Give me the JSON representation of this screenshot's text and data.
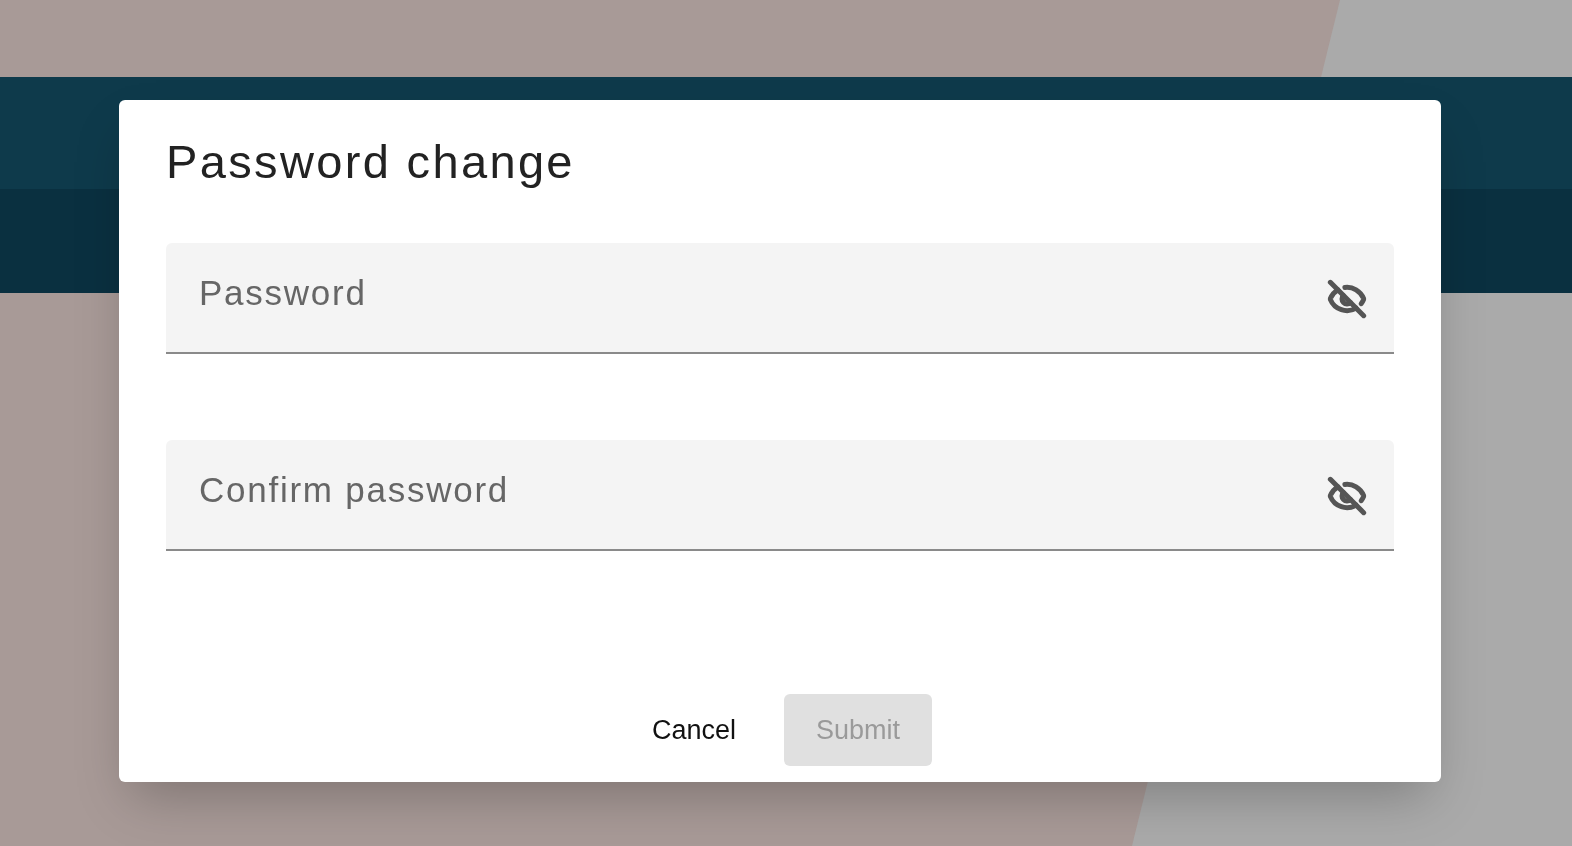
{
  "dialog": {
    "title": "Password change",
    "fields": [
      {
        "placeholder": "Password"
      },
      {
        "placeholder": "Confirm password"
      }
    ],
    "buttons": [
      {
        "label": "Cancel",
        "disabled": false
      },
      {
        "label": "Submit",
        "disabled": true
      }
    ]
  }
}
